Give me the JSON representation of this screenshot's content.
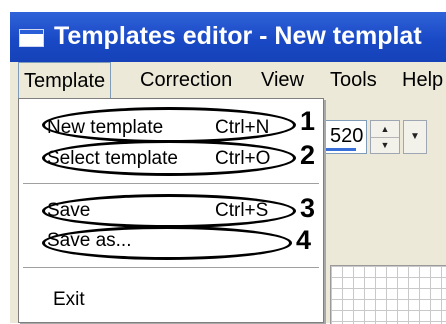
{
  "window": {
    "title": "Templates editor - New templat"
  },
  "menubar": {
    "items": [
      "Template",
      "Correction",
      "View",
      "Tools",
      "Help"
    ]
  },
  "toolbar": {
    "spin_value": "520"
  },
  "template_menu": {
    "items": [
      {
        "label": "New template",
        "shortcut": "Ctrl+N",
        "annotation": "1"
      },
      {
        "label": "Select template",
        "shortcut": "Ctrl+O",
        "annotation": "2"
      },
      {
        "label": "Save",
        "shortcut": "Ctrl+S",
        "annotation": "3"
      },
      {
        "label": "Save as...",
        "shortcut": "",
        "annotation": "4"
      },
      {
        "label": "Exit",
        "shortcut": ""
      }
    ]
  },
  "icons": {
    "window_icon": "app-window-icon",
    "spin_up": "up-arrow-icon",
    "spin_down": "down-arrow-icon",
    "dropdown": "chevron-down-icon"
  },
  "colors": {
    "titlebar": "#1a49c6",
    "menubar": "#ece9d8",
    "menu_background": "#ffffff"
  }
}
